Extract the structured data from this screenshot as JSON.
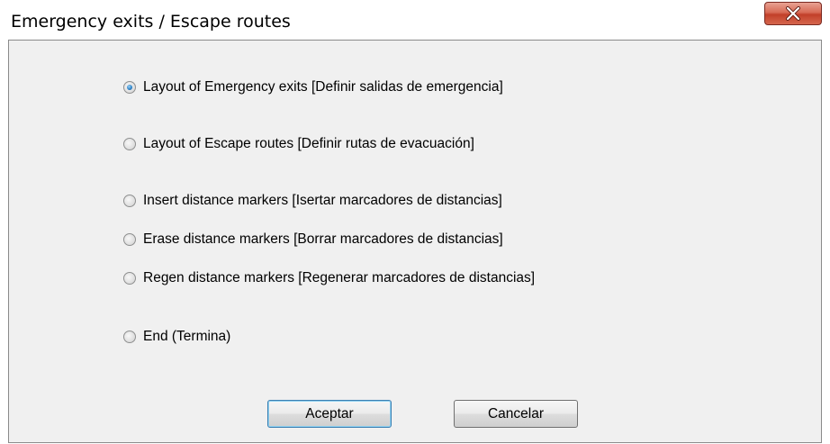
{
  "window": {
    "title": "Emergency exits / Escape routes",
    "close_icon": "close-x-icon"
  },
  "options": [
    {
      "label": "Layout of Emergency exits [Definir salidas de emergencia]",
      "checked": true
    },
    {
      "label": "Layout of Escape routes [Definir rutas de evacuación]",
      "checked": false
    },
    {
      "label": "Insert distance markers [Isertar marcadores de distancias]",
      "checked": false
    },
    {
      "label": "Erase distance markers [Borrar marcadores de distancias]",
      "checked": false
    },
    {
      "label": "Regen distance markers [Regenerar marcadores de distancias]",
      "checked": false
    },
    {
      "label": "End (Termina)",
      "checked": false
    }
  ],
  "buttons": {
    "accept_label": "Aceptar",
    "cancel_label": "Cancelar"
  },
  "colors": {
    "close_button": "#c2402a",
    "selected_radio": "#2a7fc4",
    "dialog_background": "#f0f0f0"
  }
}
